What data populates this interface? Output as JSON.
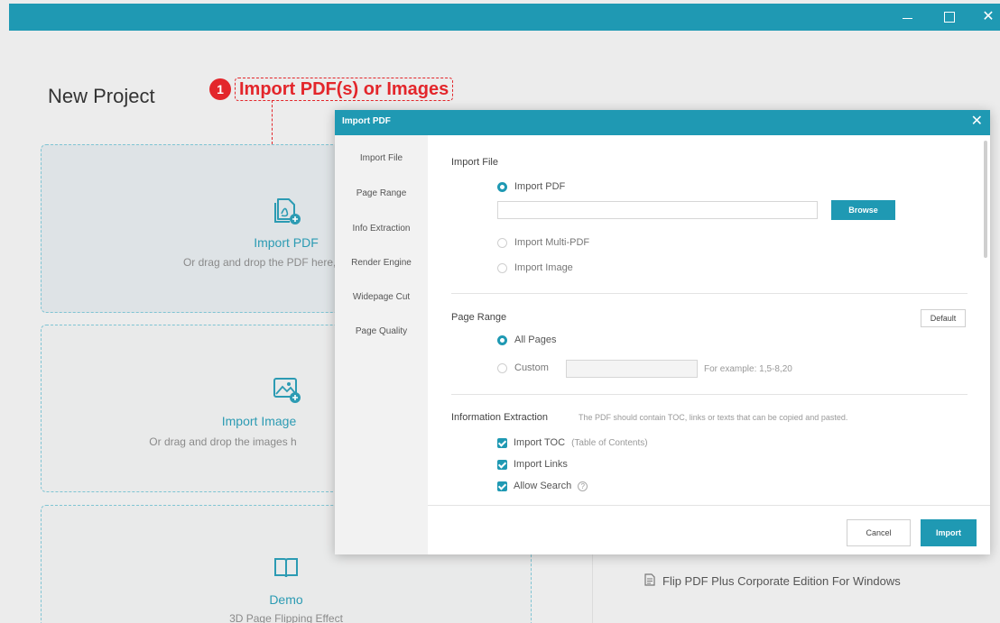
{
  "window": {
    "minimize": "—",
    "maximize": "□",
    "close": "✕"
  },
  "page": {
    "title": "New Project"
  },
  "callout": {
    "number": "1",
    "text": "Import PDF(s) or Images"
  },
  "cards": [
    {
      "title": "Import PDF",
      "subtitle": "Or drag and drop the PDF here, size",
      "icon": "import-pdf-icon"
    },
    {
      "title": "Import Image",
      "subtitle": "Or drag and drop the images h",
      "icon": "import-image-icon"
    },
    {
      "title": "Demo",
      "subtitle": "3D Page Flipping Effect",
      "icon": "book-icon"
    }
  ],
  "right": {
    "item_label": "Flip PDF Plus Corporate Edition For Windows"
  },
  "dialog": {
    "title": "Import PDF",
    "close": "✕",
    "nav": [
      "Import File",
      "Page Range",
      "Info Extraction",
      "Render Engine",
      "Widepage Cut",
      "Page Quality"
    ],
    "import_file": {
      "title": "Import File",
      "options": [
        "Import PDF",
        "Import Multi-PDF",
        "Import Image"
      ],
      "selected": "Import PDF",
      "path_value": "",
      "browse_label": "Browse"
    },
    "page_range": {
      "title": "Page Range",
      "default_label": "Default",
      "options": [
        "All Pages",
        "Custom"
      ],
      "selected": "All Pages",
      "custom_value": "",
      "custom_hint": "For example: 1,5-8,20"
    },
    "info_extraction": {
      "title": "Information Extraction",
      "hint": "The PDF should contain TOC, links or texts that can be copied and pasted.",
      "checks": [
        {
          "label": "Import TOC",
          "note": "(Table of Contents)",
          "checked": true
        },
        {
          "label": "Import Links",
          "note": "",
          "checked": true
        },
        {
          "label": "Allow Search",
          "note": "",
          "checked": true
        }
      ]
    },
    "footer": {
      "cancel_label": "Cancel",
      "import_label": "Import"
    }
  },
  "colors": {
    "accent": "#1f99b3",
    "callout_red": "#e3262b",
    "card_blue": "#2c9bb3"
  }
}
